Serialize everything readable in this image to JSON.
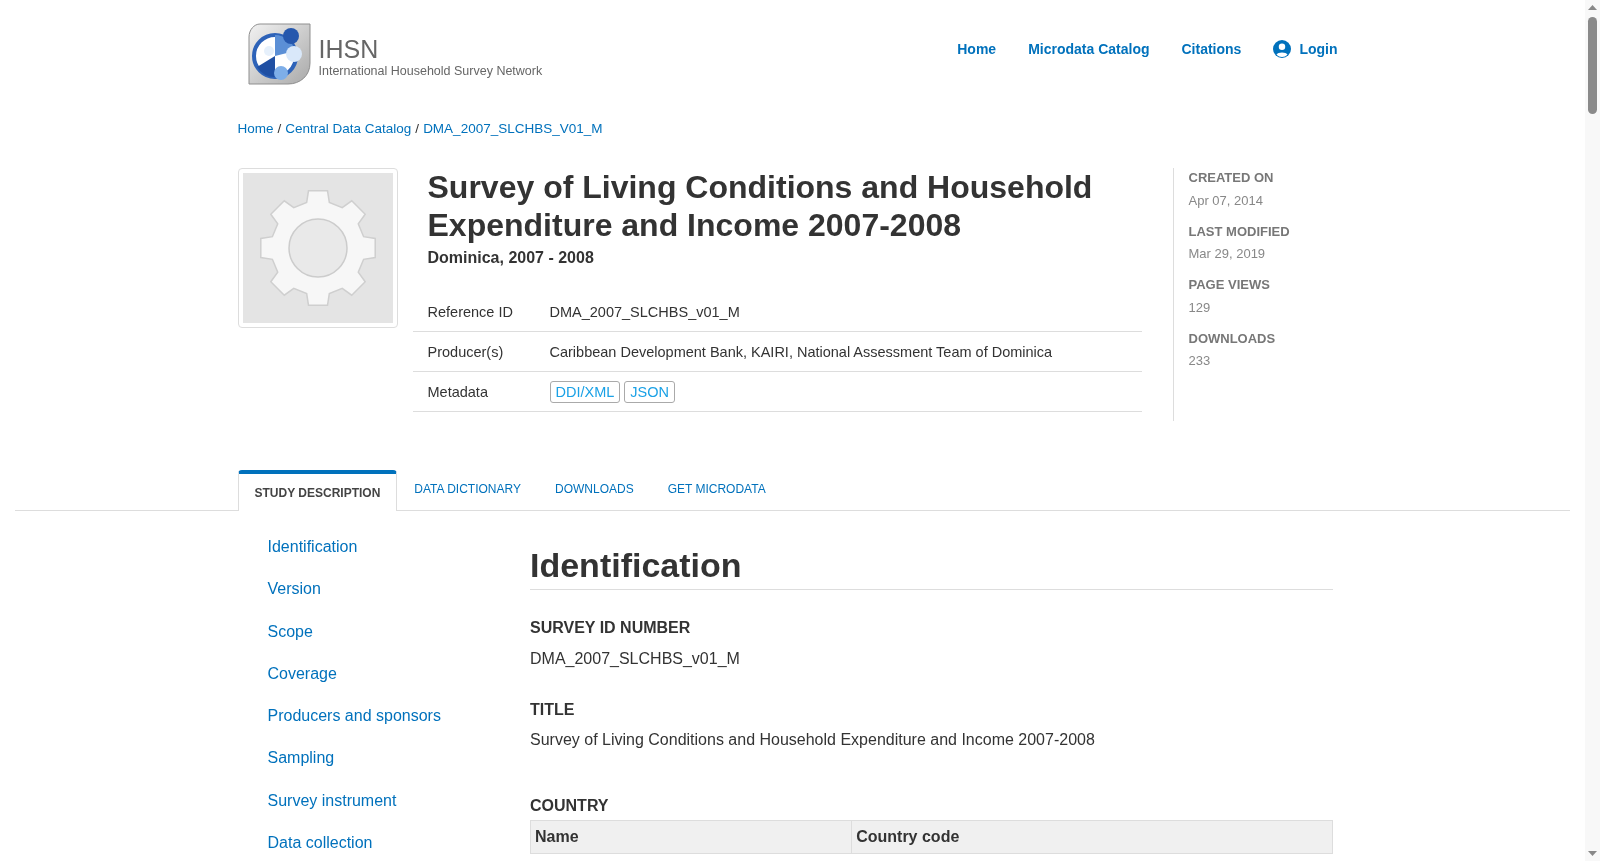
{
  "header": {
    "logo": {
      "title": "IHSN",
      "subtitle": "International Household Survey Network"
    },
    "nav": [
      {
        "label": "Home",
        "kind": "link"
      },
      {
        "label": "Microdata Catalog",
        "kind": "link"
      },
      {
        "label": "Citations",
        "kind": "link"
      },
      {
        "label": "Login",
        "kind": "login"
      }
    ]
  },
  "breadcrumb": {
    "separator": "/",
    "items": [
      "Home",
      "Central Data Catalog",
      "DMA_2007_SLCHBS_V01_M"
    ]
  },
  "study": {
    "title": "Survey of Living Conditions and Household Expenditure and Income 2007-2008",
    "subtitle": "Dominica, 2007 - 2008",
    "details": [
      {
        "label": "Reference ID",
        "kind": "text",
        "value": "DMA_2007_SLCHBS_v01_M"
      },
      {
        "label": "Producer(s)",
        "kind": "text",
        "value": "Caribbean Development Bank, KAIRI, National Assessment Team of Dominica"
      },
      {
        "label": "Metadata",
        "kind": "links",
        "links": [
          "DDI/XML",
          "JSON"
        ]
      }
    ]
  },
  "stats": [
    {
      "label": "CREATED ON",
      "value": "Apr 07, 2014"
    },
    {
      "label": "LAST MODIFIED",
      "value": "Mar 29, 2019"
    },
    {
      "label": "PAGE VIEWS",
      "value": "129"
    },
    {
      "label": "DOWNLOADS",
      "value": "233"
    }
  ],
  "tabs": [
    {
      "label": "STUDY DESCRIPTION",
      "selected": true
    },
    {
      "label": "DATA DICTIONARY",
      "selected": false
    },
    {
      "label": "DOWNLOADS",
      "selected": false
    },
    {
      "label": "GET MICRODATA",
      "selected": false
    }
  ],
  "sidebar": {
    "items": [
      "Identification",
      "Version",
      "Scope",
      "Coverage",
      "Producers and sponsors",
      "Sampling",
      "Survey instrument",
      "Data collection"
    ]
  },
  "content": {
    "heading": "Identification",
    "fields": [
      {
        "label": "SURVEY ID NUMBER",
        "kind": "text",
        "value": "DMA_2007_SLCHBS_v01_M"
      },
      {
        "label": "TITLE",
        "kind": "text",
        "value": "Survey of Living Conditions and Household Expenditure and Income 2007-2008"
      },
      {
        "label": "COUNTRY",
        "kind": "table",
        "columns": [
          "Name",
          "Country code"
        ]
      }
    ]
  }
}
